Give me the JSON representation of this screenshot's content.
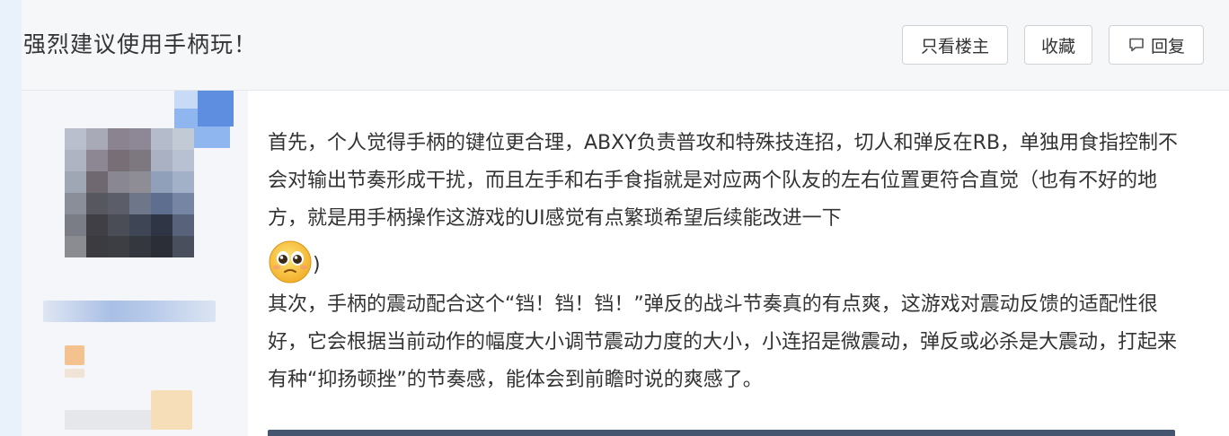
{
  "header": {
    "title": "强烈建议使用手柄玩！",
    "buttons": {
      "only_op": "只看楼主",
      "favorite": "收藏",
      "reply": "回复"
    }
  },
  "post": {
    "paragraph1": "首先，个人觉得手柄的键位更合理，ABXY负责普攻和特殊技连招，切人和弹反在RB，单独用食指控制不会对输出节奏形成干扰，而且左手和右手食指就是对应两个队友的左右位置更符合直觉（也有不好的地方，就是用手柄操作这游戏的UI感觉有点繁琐希望后续能改进一下",
    "emoji_icon": "pleading-face-emoji",
    "paragraph1_end": ")",
    "paragraph2": "其次，手柄的震动配合这个“铛！铛！铛！”弹反的战斗节奏真的有点爽，这游戏对震动反馈的适配性很好，它会根据当前动作的幅度大小调节震动力度的大小，小连招是微震动，弹反或必杀是大震动，打起来有种“抑扬顿挫”的节奏感，能体会到前瞻时说的爽感了。"
  },
  "colors": {
    "header_bg": "#f6f7f9",
    "author_bg": "#f4f6f9",
    "accent_blue": "#6e9be0",
    "text": "#333333"
  }
}
